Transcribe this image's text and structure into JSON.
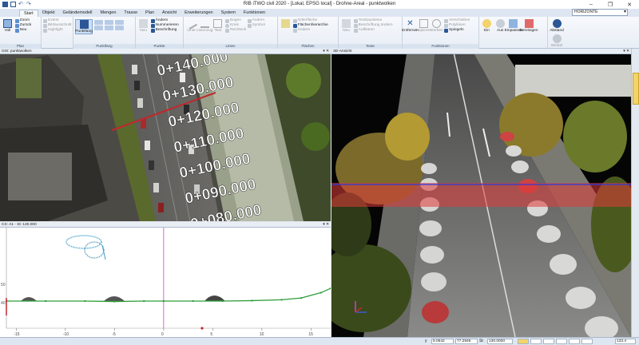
{
  "window": {
    "title": "RIB iTWO civil 2020 - [Lokal, EPSG local] - Drohne-Areal - punktwolken"
  },
  "tabs": [
    "Start",
    "Objekt",
    "Geländemodell",
    "Mengen",
    "Trasse",
    "Plan",
    "Ansicht",
    "Erweiterungen",
    "System",
    "Funktionen"
  ],
  "active_tab": "Start",
  "view_selector": {
    "value": "HORIZONTE"
  },
  "ribbon": {
    "groups": [
      {
        "label": "Plan",
        "items": [
          "Zoom",
          "Zurück",
          "Neu"
        ],
        "big": "Voll"
      },
      {
        "label": "",
        "items": [
          "Extent",
          "Bildausschnitt",
          "Highlight"
        ]
      },
      {
        "label": "Punktfang",
        "big": "Punktfang"
      },
      {
        "label": "Punkte",
        "items": [
          "Ändern",
          "Nummerieren",
          "Beschriftung"
        ],
        "big": "Neu"
      },
      {
        "label": "Linien",
        "items": [
          "Linie",
          "Linienzug",
          "Text",
          "Bogen",
          "Kreis",
          "Rechteck",
          "Ändern",
          "Symbol"
        ]
      },
      {
        "label": "Flächen",
        "items": [
          "Flächenhierarchie",
          "Gitterfläche",
          "Ändern"
        ]
      },
      {
        "label": "Texte",
        "items": [
          "Neu",
          "Textbausteine",
          "Beschriftung ändern",
          "Aufklären"
        ]
      },
      {
        "label": "Funktionen",
        "items": [
          "Entfernen",
          "Kopieren",
          "Drehen",
          "Verschieben",
          "Spiegeln",
          "Polylinien"
        ]
      },
      {
        "label": "",
        "items": [
          "Ein",
          "Aus",
          "Einpassen",
          "Bereinigen"
        ]
      },
      {
        "label": "",
        "items": [
          "Abstand",
          "Winkel"
        ]
      }
    ]
  },
  "panels": {
    "top_left": {
      "title": "GIS: punktwolken",
      "stations": [
        "0+140.000",
        "0+130.000",
        "0+120.000",
        "0+110.000",
        "0+100.000",
        "0+090.000",
        "0+080.000"
      ]
    },
    "bottom_left": {
      "title": "CS: A1 - St: 130.000",
      "x_ticks": [
        "-15",
        "-10",
        "-5",
        "0",
        "5",
        "10",
        "15"
      ],
      "y_ticks": [
        "50",
        "40"
      ]
    },
    "right": {
      "title": "3D-Ansicht"
    }
  },
  "statusbar": {
    "coords_label": "y",
    "y_value": "5.0642",
    "x_value": "77.2946",
    "st_label": "St",
    "st_value": "130.0000",
    "zoom": "133.4"
  },
  "colors": {
    "ribbon_accent": "#2b5797",
    "section_line": "#c0282c",
    "profile_line": "#2e9e3a",
    "cursor_line": "#d53bd5"
  },
  "chart_data": {
    "type": "line",
    "title": "CS: A1 - St: 130.000",
    "xlabel": "",
    "ylabel": "",
    "xlim": [
      -16,
      17
    ],
    "series": [
      {
        "x": [
          -16,
          -12,
          -8,
          -5,
          -2,
          0,
          3,
          6,
          9,
          12,
          14,
          16,
          17
        ],
        "y": [
          40.3,
          40.3,
          40.3,
          40.2,
          40.3,
          40.3,
          40.3,
          40.3,
          40.4,
          40.6,
          41.0,
          42.2,
          43.2
        ]
      }
    ]
  }
}
